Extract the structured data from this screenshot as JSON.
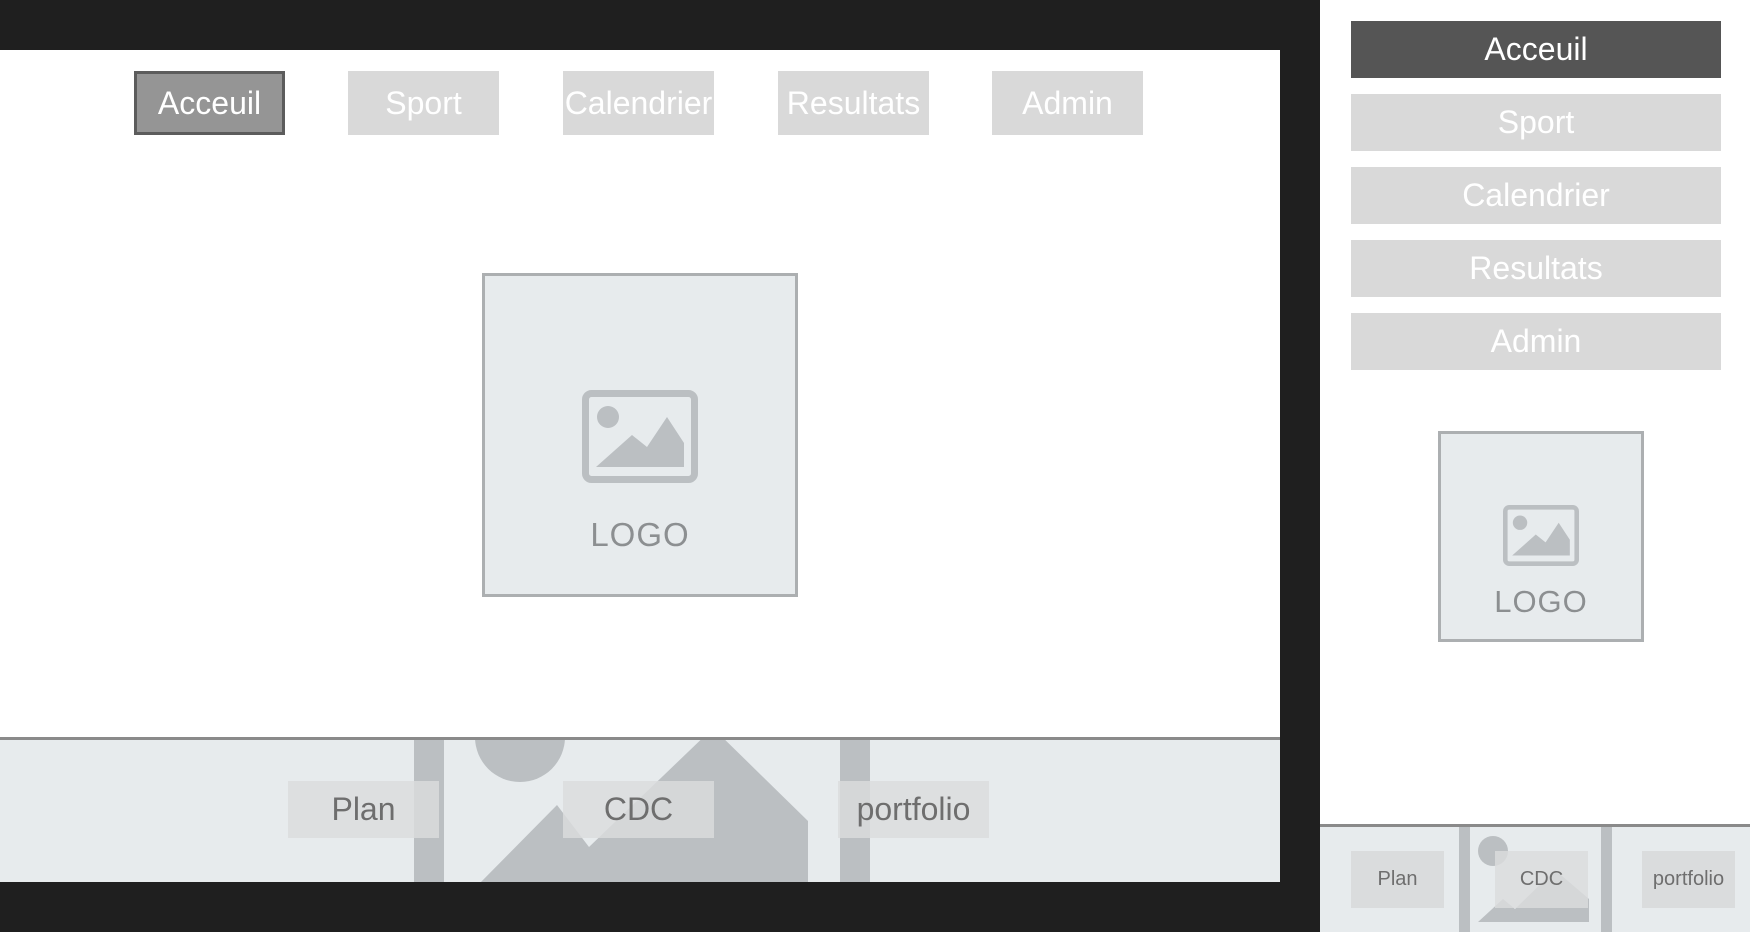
{
  "desktop": {
    "nav": [
      {
        "label": "Acceuil",
        "active": true
      },
      {
        "label": "Sport",
        "active": false
      },
      {
        "label": "Calendrier",
        "active": false
      },
      {
        "label": "Resultats",
        "active": false
      },
      {
        "label": "Admin",
        "active": false
      }
    ],
    "logo": {
      "label": "LOGO",
      "icon": "image-placeholder-icon"
    },
    "footer": {
      "links": [
        {
          "label": "Plan"
        },
        {
          "label": "CDC"
        },
        {
          "label": "portfolio"
        }
      ],
      "background_icon": "image-placeholder-icon"
    }
  },
  "mobile": {
    "nav": [
      {
        "label": "Acceuil",
        "active": true
      },
      {
        "label": "Sport",
        "active": false
      },
      {
        "label": "Calendrier",
        "active": false
      },
      {
        "label": "Resultats",
        "active": false
      },
      {
        "label": "Admin",
        "active": false
      }
    ],
    "logo": {
      "label": "LOGO",
      "icon": "image-placeholder-icon"
    },
    "footer": {
      "links": [
        {
          "label": "Plan"
        },
        {
          "label": "CDC"
        },
        {
          "label": "portfolio"
        }
      ],
      "background_icon": "image-placeholder-icon"
    }
  },
  "colors": {
    "frame_bg": "#1f1f1f",
    "artboard_bg": "#ffffff",
    "button_bg": "#d9d9d9",
    "desktop_active_bg": "#959595",
    "mobile_active_bg": "#555555",
    "placeholder_bg": "#e7ebed",
    "placeholder_icon": "#bbbfc2",
    "footer_border": "#8a8a8a"
  }
}
